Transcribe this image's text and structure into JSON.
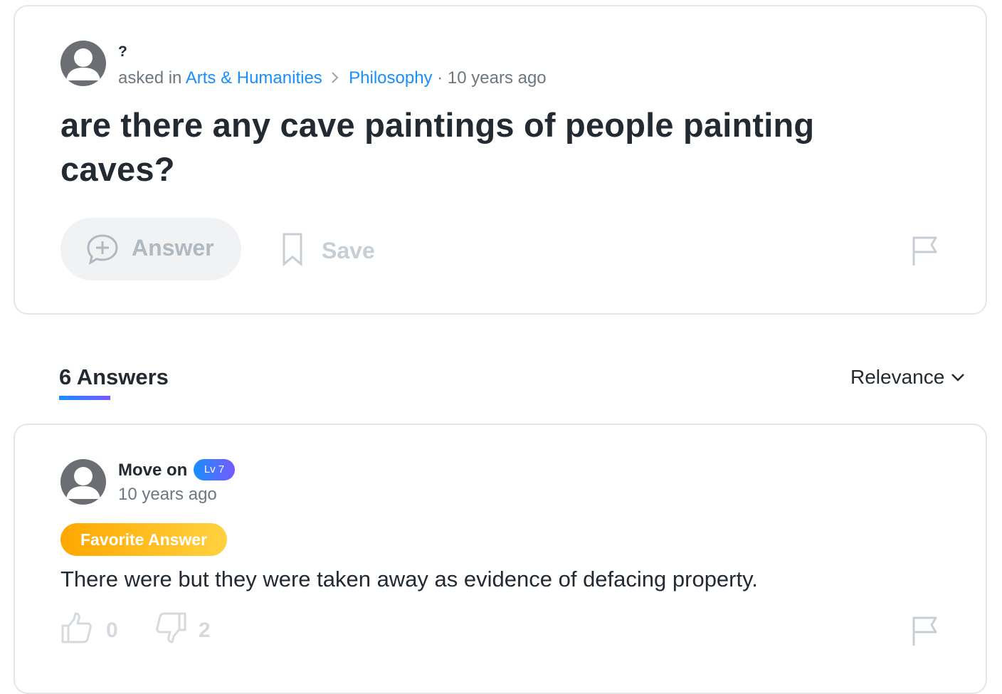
{
  "question": {
    "asker": "?",
    "asked_prefix": "asked in",
    "category": "Arts & Humanities",
    "subcategory": "Philosophy",
    "time": "· 10 years ago",
    "title": "are there any cave paintings of people painting caves?",
    "answer_label": "Answer",
    "save_label": "Save",
    "icons": [
      "avatar-icon",
      "answer-plus-icon",
      "bookmark-icon",
      "chevron-right-icon",
      "flag-icon"
    ]
  },
  "answers_section": {
    "heading": "6 Answers",
    "sort_label": "Relevance"
  },
  "answer": {
    "author": "Move on",
    "level": "Lv 7",
    "time": "10 years ago",
    "favorite_label": "Favorite Answer",
    "text": "There were but they were taken away as evidence of defacing property.",
    "thumbs_up": "0",
    "thumbs_down": "2"
  },
  "colors": {
    "link": "#188fff",
    "level_gradient": [
      "#188fff",
      "#7759ff"
    ],
    "favorite_gradient": [
      "#ffa700",
      "#ffd23f"
    ]
  }
}
